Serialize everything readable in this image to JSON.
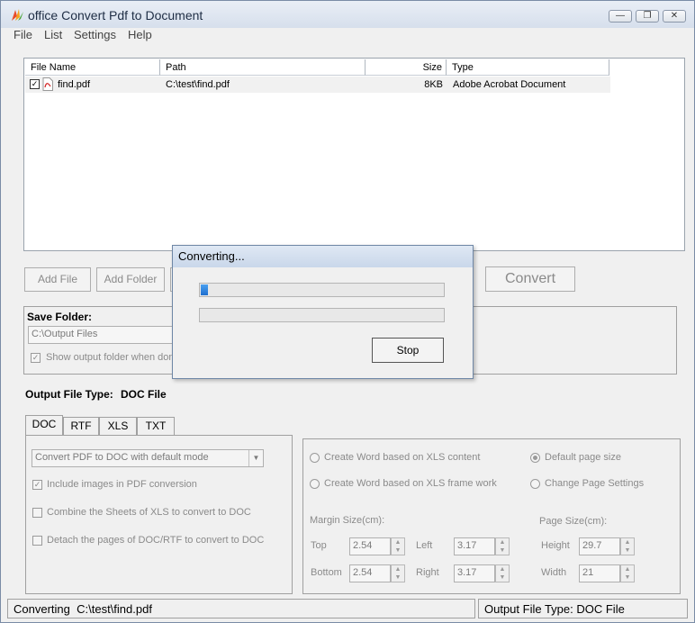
{
  "window": {
    "title": "office Convert Pdf to Document",
    "controls": {
      "minimize": "—",
      "restore": "❐",
      "close": "✕"
    }
  },
  "menu": [
    "File",
    "List",
    "Settings",
    "Help"
  ],
  "filelist": {
    "columns": [
      "File Name",
      "Path",
      "Size",
      "Type"
    ],
    "rows": [
      {
        "checked": true,
        "name": "find.pdf",
        "path": "C:\\test\\find.pdf",
        "size": "8KB",
        "type": "Adobe Acrobat Document"
      }
    ]
  },
  "buttons": {
    "add_file": "Add File",
    "add_folder": "Add Folder",
    "convert": "Convert"
  },
  "save": {
    "label": "Save Folder:",
    "path": "C:\\Output Files",
    "show_folder_label": "Show output folder when don"
  },
  "output_type": {
    "label": "Output File Type:",
    "value": "DOC File"
  },
  "tabs": [
    "DOC",
    "RTF",
    "XLS",
    "TXT"
  ],
  "doc_options": {
    "mode_select": "Convert PDF to DOC with default mode",
    "include_images": "Include images in PDF conversion",
    "combine_sheets": "Combine the Sheets of XLS to convert to DOC",
    "detach_pages": "Detach the pages of DOC/RTF to convert to DOC"
  },
  "word_options": {
    "create_xls_content": "Create Word based on XLS content",
    "create_xls_frame": "Create Word based on XLS frame work",
    "default_page_size": "Default page size",
    "change_page_settings": "Change Page Settings",
    "margin_label": "Margin Size(cm):",
    "page_label": "Page Size(cm):",
    "top_label": "Top",
    "top": "2.54",
    "left_label": "Left",
    "left": "3.17",
    "bottom_label": "Bottom",
    "bottom": "2.54",
    "right_label": "Right",
    "right": "3.17",
    "height_label": "Height",
    "height": "29.7",
    "width_label": "Width",
    "width": "21"
  },
  "dialog": {
    "title": "Converting...",
    "progress1": 0.03,
    "progress2": 0.0,
    "stop": "Stop"
  },
  "status": {
    "converting_label": "Converting",
    "converting_file": "C:\\test\\find.pdf",
    "output_type": "Output File Type:  DOC File"
  },
  "colors": {
    "progress": "#1f6fcf",
    "accent_title": "#d6dfec"
  },
  "icons": {
    "app": "leaf-logo-icon",
    "pdf": "pdf-file-icon",
    "check": "✓"
  }
}
